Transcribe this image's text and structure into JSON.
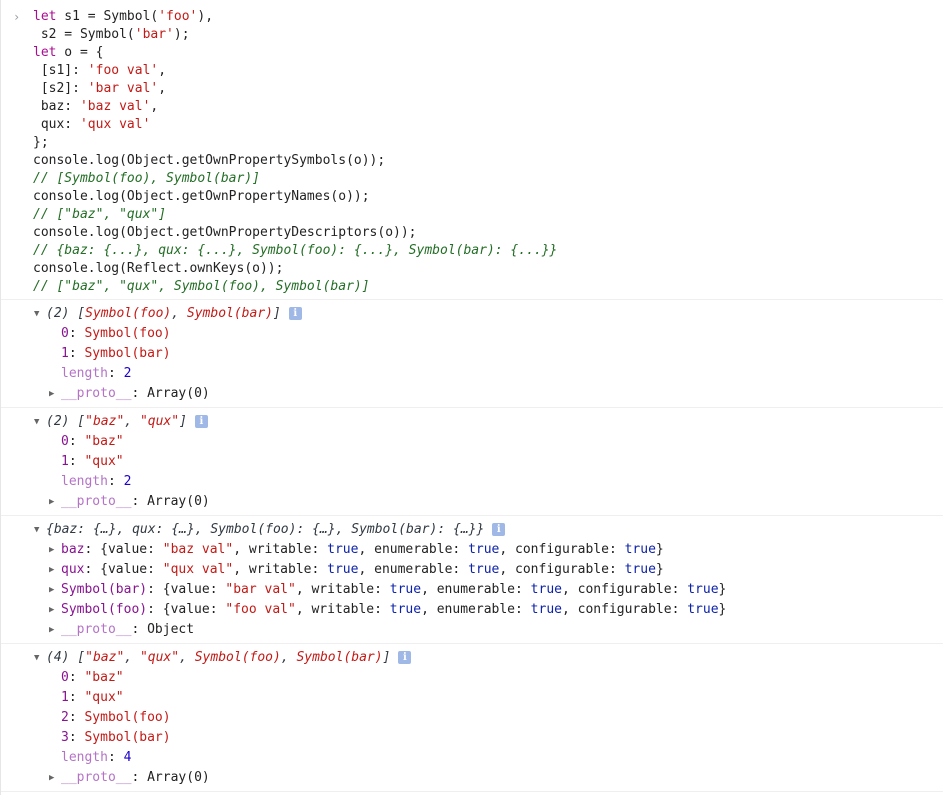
{
  "input": {
    "prompt": "›",
    "lines": [
      "let s1 = Symbol('foo'),",
      " s2 = Symbol('bar');",
      "let o = {",
      " [s1]: 'foo val',",
      " [s2]: 'bar val',",
      " baz: 'baz val',",
      " qux: 'qux val'",
      "};",
      "console.log(Object.getOwnPropertySymbols(o));",
      "// [Symbol(foo), Symbol(bar)]",
      "console.log(Object.getOwnPropertyNames(o));",
      "// [\"baz\", \"qux\"]",
      "console.log(Object.getOwnPropertyDescriptors(o));",
      "// {baz: {...}, qux: {...}, Symbol(foo): {...}, Symbol(bar): {...}}",
      "console.log(Reflect.ownKeys(o));",
      "// [\"baz\", \"qux\", Symbol(foo), Symbol(bar)]"
    ]
  },
  "outputs": {
    "symbols": {
      "head_count": "(2)",
      "head_open": "[",
      "head_items": [
        "Symbol(foo)",
        "Symbol(bar)"
      ],
      "head_close": "]",
      "rows": [
        {
          "key": "0",
          "value": "Symbol(foo)"
        },
        {
          "key": "1",
          "value": "Symbol(bar)"
        }
      ],
      "length_key": "length",
      "length_val": "2",
      "proto_key": "__proto__",
      "proto_val": "Array(0)"
    },
    "names": {
      "head_count": "(2)",
      "head_items": [
        "\"baz\"",
        "\"qux\""
      ],
      "rows": [
        {
          "key": "0",
          "value": "\"baz\""
        },
        {
          "key": "1",
          "value": "\"qux\""
        }
      ],
      "length_key": "length",
      "length_val": "2",
      "proto_key": "__proto__",
      "proto_val": "Array(0)"
    },
    "descriptors": {
      "head": "{baz: {…}, qux: {…}, Symbol(foo): {…}, Symbol(bar): {…}}",
      "rows": [
        {
          "key": "baz",
          "value": "\"baz val\"",
          "writable": "true",
          "enumerable": "true",
          "configurable": "true"
        },
        {
          "key": "qux",
          "value": "\"qux val\"",
          "writable": "true",
          "enumerable": "true",
          "configurable": "true"
        },
        {
          "key": "Symbol(bar)",
          "value": "\"bar val\"",
          "writable": "true",
          "enumerable": "true",
          "configurable": "true"
        },
        {
          "key": "Symbol(foo)",
          "value": "\"foo val\"",
          "writable": "true",
          "enumerable": "true",
          "configurable": "true"
        }
      ],
      "labels": {
        "value": "value",
        "writable": "writable",
        "enumerable": "enumerable",
        "configurable": "configurable"
      },
      "proto_key": "__proto__",
      "proto_val": "Object"
    },
    "ownkeys": {
      "head_count": "(4)",
      "head_items": [
        "\"baz\"",
        "\"qux\"",
        "Symbol(foo)",
        "Symbol(bar)"
      ],
      "rows": [
        {
          "key": "0",
          "value": "\"baz\""
        },
        {
          "key": "1",
          "value": "\"qux\""
        },
        {
          "key": "2",
          "value": "Symbol(foo)"
        },
        {
          "key": "3",
          "value": "Symbol(bar)"
        }
      ],
      "length_key": "length",
      "length_val": "4",
      "proto_key": "__proto__",
      "proto_val": "Array(0)"
    }
  },
  "icons": {
    "expanded": "triangle-down-icon",
    "collapsed": "triangle-right-icon",
    "info": "info-icon"
  },
  "info_glyph": "i",
  "colors": {
    "string": "#c41a16",
    "keyword": "#aa0d91",
    "comment": "#236e25",
    "number": "#1c00cf",
    "key": "#881391"
  }
}
